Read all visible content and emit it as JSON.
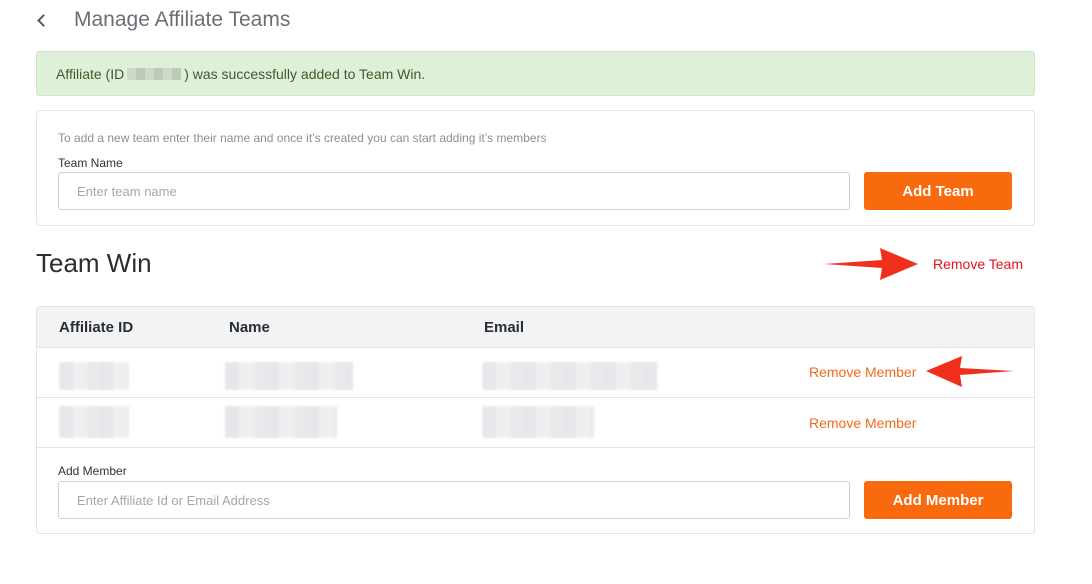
{
  "header": {
    "title": "Manage Affiliate Teams"
  },
  "alert": {
    "prefix": "Affiliate (ID ",
    "suffix": ") was successfully added to Team Win."
  },
  "new_team": {
    "hint": "To add a new team enter their name and once it’s created you can start adding it’s members",
    "label": "Team Name",
    "placeholder": "Enter team name",
    "button": "Add Team"
  },
  "team": {
    "name": "Team Win",
    "remove_label": "Remove Team",
    "columns": [
      "Affiliate ID",
      "Name",
      "Email"
    ],
    "rows": [
      {
        "action": "Remove Member"
      },
      {
        "action": "Remove Member"
      }
    ],
    "add_label": "Add Member",
    "add_placeholder": "Enter Affiliate Id or Email Address",
    "add_button": "Add Member"
  },
  "colors": {
    "accent": "#f96a0e",
    "danger": "#e3131b",
    "success_bg": "#dff0d8",
    "annotation_arrow": "#f0301c"
  },
  "icons": {
    "back": "chevron-left-icon",
    "annotation": "arrow-annotation-icon"
  }
}
